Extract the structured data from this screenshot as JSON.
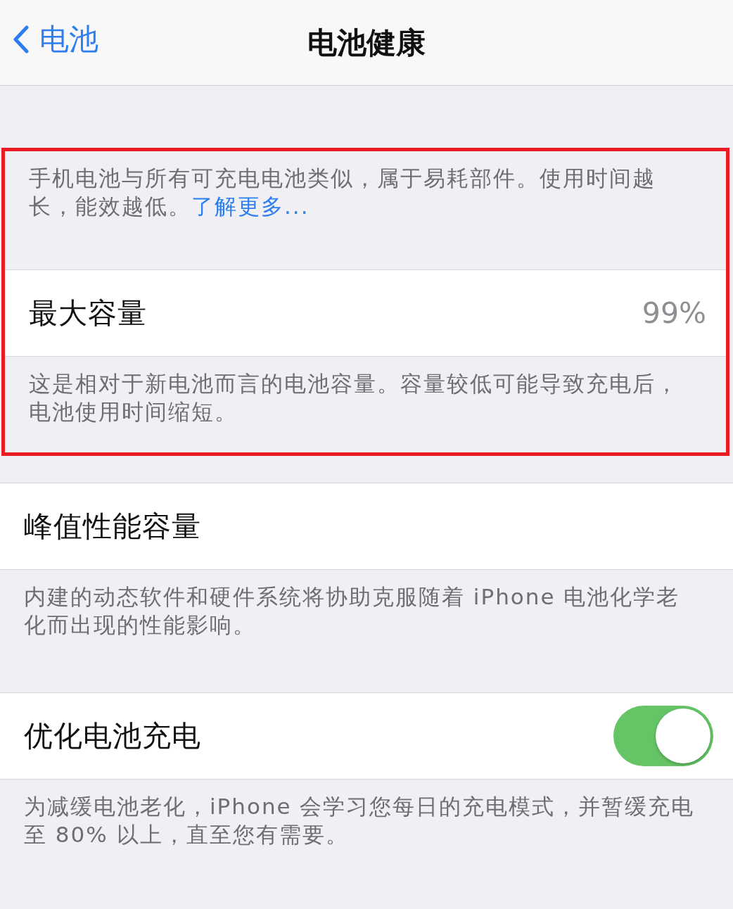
{
  "nav": {
    "back_label": "电池",
    "title": "电池健康"
  },
  "sections": [
    {
      "highlighted": true,
      "items": [
        {
          "kind": "note",
          "text": "手机电池与所有可充电电池类似，属于易耗部件。使用时间越长，能效越低。",
          "link": "了解更多..."
        },
        {
          "kind": "value",
          "label": "最大容量",
          "value": "99%"
        },
        {
          "kind": "note",
          "text": "这是相对于新电池而言的电池容量。容量较低可能导致充电后，电池使用时间缩短。"
        }
      ]
    },
    {
      "highlighted": false,
      "items": [
        {
          "kind": "plain",
          "label": "峰值性能容量"
        },
        {
          "kind": "note",
          "text": "内建的动态软件和硬件系统将协助克服随着 iPhone 电池化学老化而出现的性能影响。"
        }
      ]
    },
    {
      "highlighted": false,
      "items": [
        {
          "kind": "toggle",
          "label": "优化电池充电",
          "on": true
        },
        {
          "kind": "note",
          "text": "为减缓电池老化，iPhone 会学习您每日的充电模式，并暂缓充电至 80% 以上，直至您有需要。"
        }
      ]
    }
  ]
}
